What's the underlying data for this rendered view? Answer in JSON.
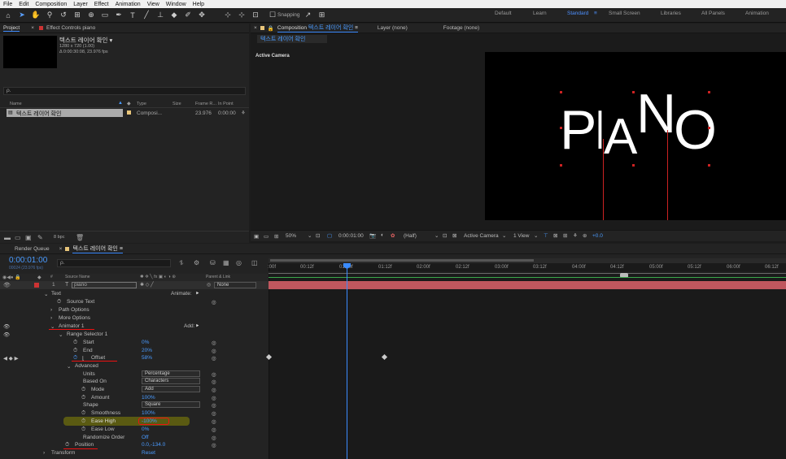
{
  "menu": [
    "File",
    "Edit",
    "Composition",
    "Layer",
    "Effect",
    "Animation",
    "View",
    "Window",
    "Help"
  ],
  "toolbar": {
    "snapping": "Snapping"
  },
  "workspaces": {
    "default": "Default",
    "learn": "Learn",
    "standard": "Standard",
    "small_screen": "Small Screen",
    "libraries": "Libraries",
    "all_panels": "All Panels",
    "animation": "Animation"
  },
  "project": {
    "tab": "Project",
    "effect_tab": "Effect Controls piano",
    "comp_name": "텍스트 레이어 확인 ▾",
    "comp_res": "1280 x 720 (1.00)",
    "comp_dur": "Δ 0:00:30:08, 23.976 fps",
    "search_placeholder": "ρ.",
    "columns": {
      "name": "Name",
      "type": "Type",
      "size": "Size",
      "frame_rate": "Frame R...",
      "in_point": "In Point"
    },
    "item": {
      "name": "텍스트 레이어 확인",
      "type": "Composi...",
      "fps": "23.976",
      "in": "0:00:00"
    },
    "bpc": "8 bpc"
  },
  "composition": {
    "tab_prefix": "Composition",
    "tab_name": "텍스트 레이어 확인",
    "layer_tab": "Layer (none)",
    "footage_tab": "Footage (none)",
    "sub_tab": "텍스트 레이어 확인",
    "active_camera": "Active Camera",
    "canvas_text": [
      "P",
      "I",
      "A",
      "N",
      "O"
    ],
    "bottom": {
      "zoom": "50%",
      "time": "0:00:01:00",
      "quality": "(Half)",
      "camera": "Active Camera",
      "views": "1 View",
      "exposure": "+0.0"
    }
  },
  "timeline": {
    "render_tab": "Render Queue",
    "comp_tab": "텍스트 레이어 확인",
    "current_time": "0:00:01:00",
    "frame_info": "00024 (23.976 fps)",
    "search_placeholder": "ρ.",
    "header": {
      "source_name": "Source Name",
      "parent": "Parent & Link"
    },
    "layer": {
      "num": "1",
      "name": "piano",
      "parent": "None"
    },
    "ruler": [
      ":00f",
      "00:12f",
      "01:00f",
      "01:12f",
      "02:00f",
      "02:12f",
      "03:00f",
      "03:12f",
      "04:00f",
      "04:12f",
      "05:00f",
      "05:12f",
      "06:00f",
      "06:12f"
    ],
    "props": [
      {
        "label": "Text",
        "value": "",
        "extra": "Animate:"
      },
      {
        "label": "Source Text",
        "value": ""
      },
      {
        "label": "Path Options",
        "value": ""
      },
      {
        "label": "More Options",
        "value": ""
      },
      {
        "label": "Animator 1",
        "value": "",
        "extra": "Add:"
      },
      {
        "label": "Range Selector 1",
        "value": ""
      },
      {
        "label": "Start",
        "value": "0%"
      },
      {
        "label": "End",
        "value": "20%"
      },
      {
        "label": "Offset",
        "value": "58%"
      },
      {
        "label": "Advanced",
        "value": ""
      },
      {
        "label": "Units",
        "value": "Percentage"
      },
      {
        "label": "Based On",
        "value": "Characters"
      },
      {
        "label": "Mode",
        "value": "Add"
      },
      {
        "label": "Amount",
        "value": "100%"
      },
      {
        "label": "Shape",
        "value": "Square"
      },
      {
        "label": "Smoothness",
        "value": "100%"
      },
      {
        "label": "Ease High",
        "value": "-100%"
      },
      {
        "label": "Ease Low",
        "value": "0%"
      },
      {
        "label": "Randomize Order",
        "value": "Off"
      },
      {
        "label": "Position",
        "value": "0.0,-134.0"
      },
      {
        "label": "Transform",
        "value": "Reset"
      }
    ]
  }
}
